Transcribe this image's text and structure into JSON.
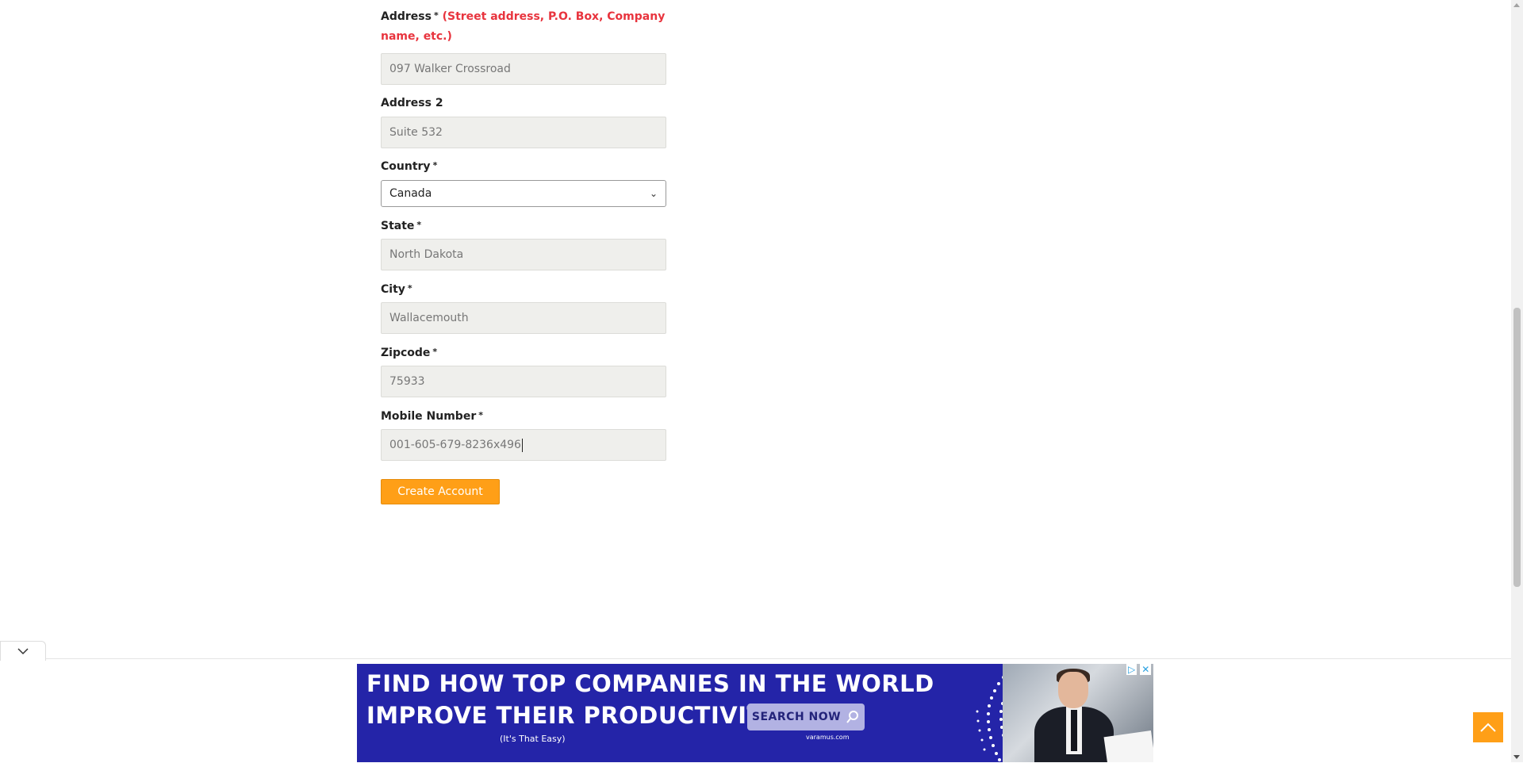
{
  "form": {
    "address": {
      "label": "Address",
      "required": "*",
      "hint": "(Street address, P.O. Box, Company name, etc.)",
      "value": "097 Walker Crossroad"
    },
    "address2": {
      "label": "Address 2",
      "value": "Suite 532"
    },
    "country": {
      "label": "Country",
      "required": "*",
      "selected": "Canada"
    },
    "state": {
      "label": "State",
      "required": "*",
      "value": "North Dakota"
    },
    "city": {
      "label": "City",
      "required": "*",
      "value": "Wallacemouth"
    },
    "zipcode": {
      "label": "Zipcode",
      "required": "*",
      "value": "75933"
    },
    "mobile": {
      "label": "Mobile Number",
      "required": "*",
      "value": "001-605-679-8236x496"
    },
    "submit_label": "Create Account"
  },
  "ad": {
    "line1": "FIND HOW TOP COMPANIES IN THE WORLD",
    "line2": "IMPROVE THEIR PRODUCTIVITY",
    "search_label": "SEARCH NOW",
    "tagline": "(It's That Easy)",
    "brand": "varamus.com"
  },
  "colors": {
    "accent": "#ff9f17",
    "required_hint": "#e8343e",
    "ad_background": "#2424a8"
  },
  "icons": {
    "collapse": "chevron-down-icon",
    "scroll_top": "arrow-up-icon",
    "ad_info": "adchoices-icon",
    "ad_close": "close-icon"
  }
}
